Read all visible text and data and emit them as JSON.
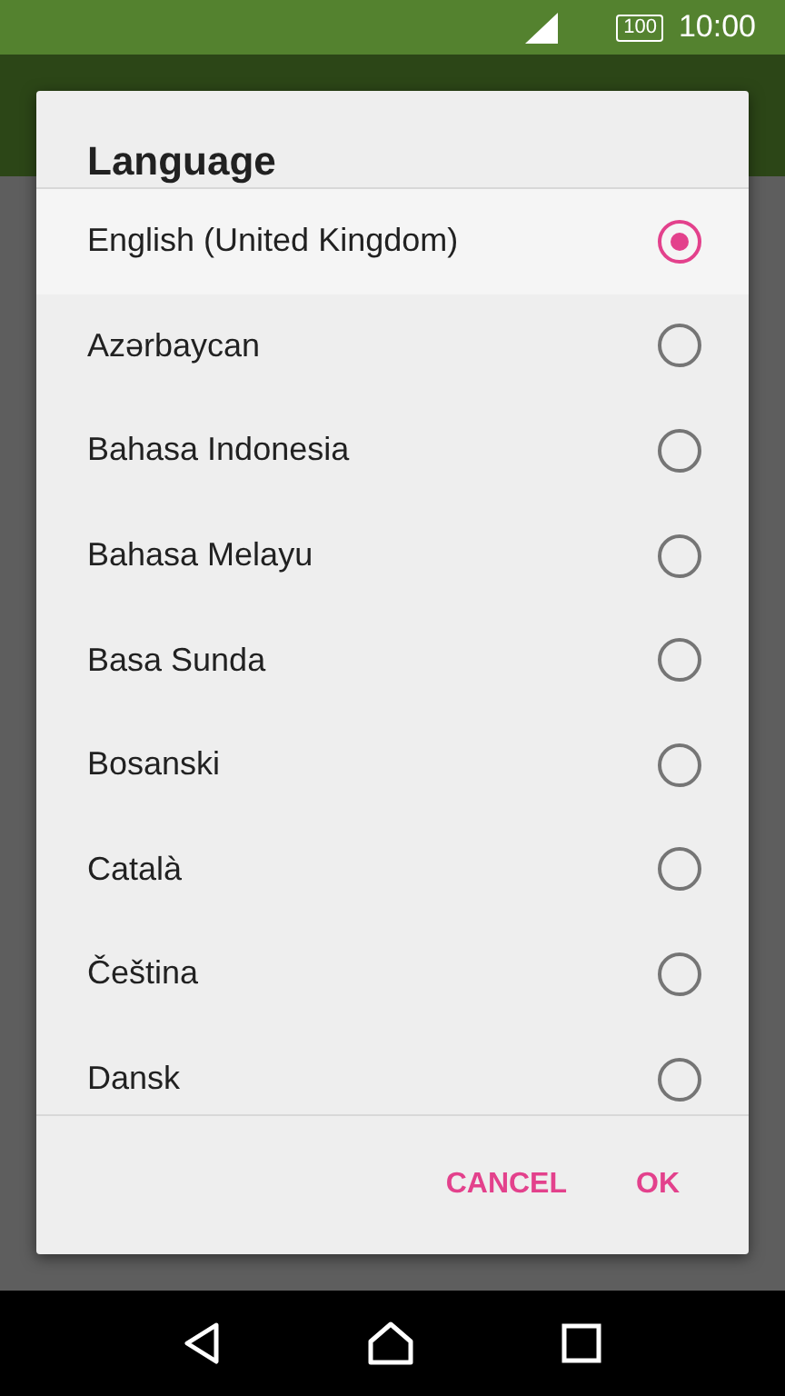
{
  "status_bar": {
    "battery": "100",
    "time": "10:00"
  },
  "dialog": {
    "title": "Language",
    "options": [
      {
        "label": "English (United Kingdom)",
        "selected": true
      },
      {
        "label": "Azərbaycan",
        "selected": false
      },
      {
        "label": "Bahasa Indonesia",
        "selected": false
      },
      {
        "label": "Bahasa Melayu",
        "selected": false
      },
      {
        "label": "Basa Sunda",
        "selected": false
      },
      {
        "label": "Bosanski",
        "selected": false
      },
      {
        "label": "Català",
        "selected": false
      },
      {
        "label": "Čeština",
        "selected": false
      },
      {
        "label": "Dansk",
        "selected": false
      }
    ],
    "buttons": [
      "CANCEL",
      "OK"
    ]
  }
}
